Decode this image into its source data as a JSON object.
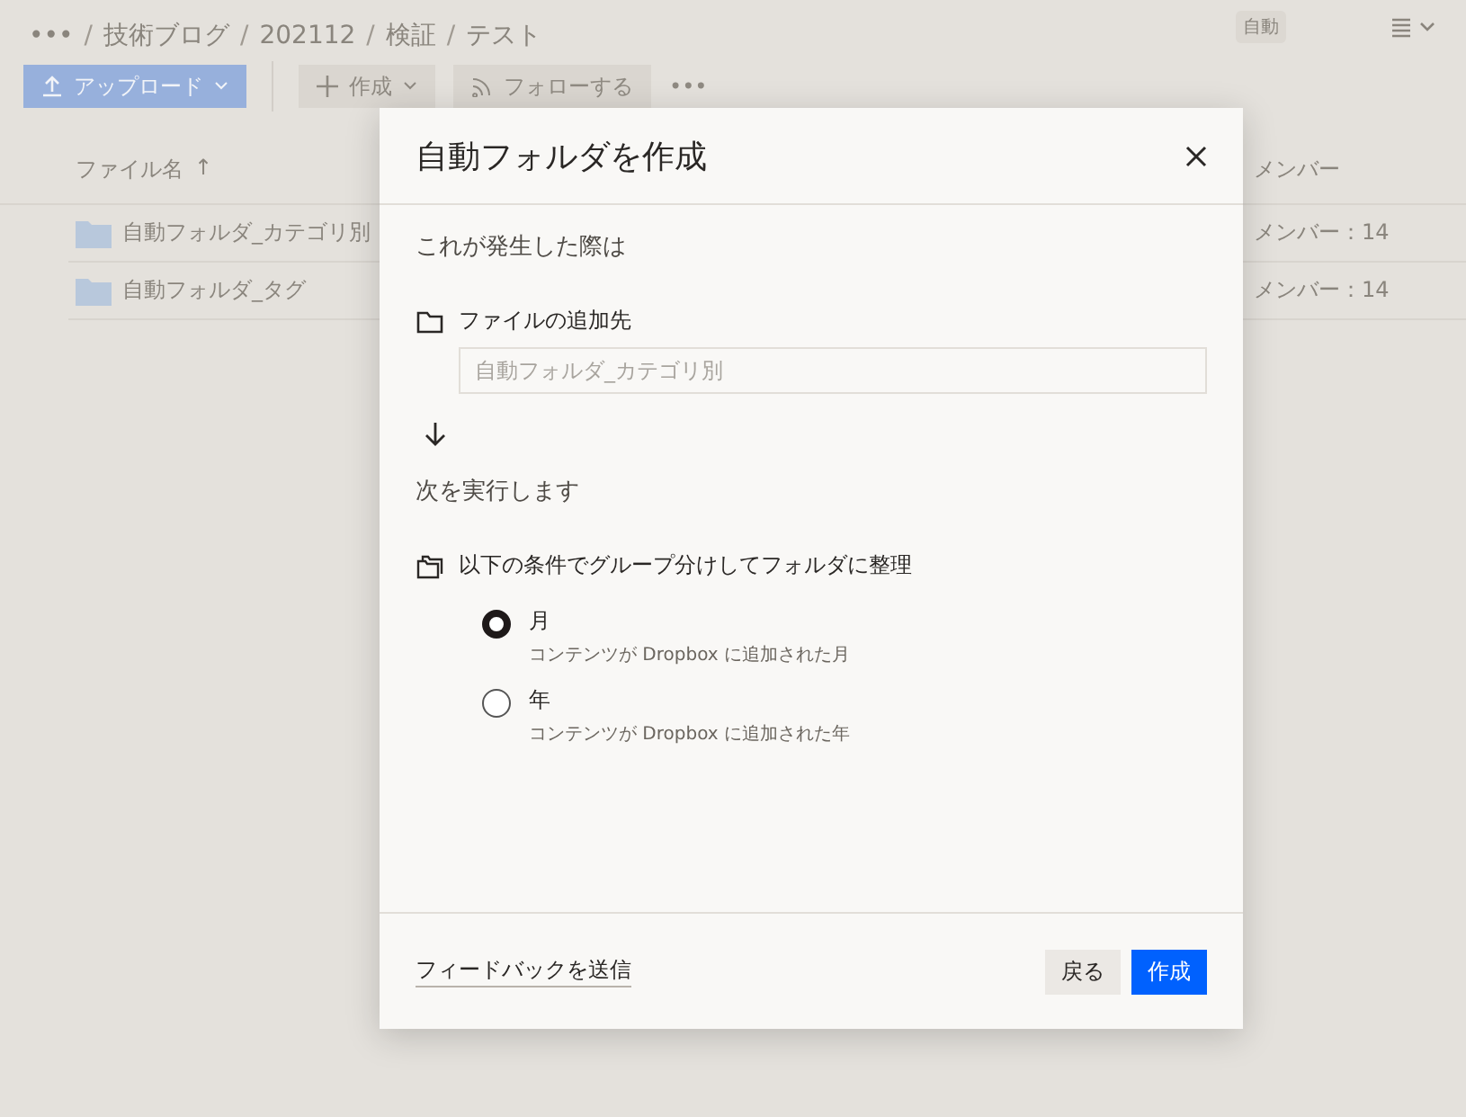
{
  "breadcrumb": {
    "more": "•••",
    "separator": "/",
    "items": [
      "技術ブログ",
      "202112",
      "検証",
      "テスト"
    ]
  },
  "badge": "自動",
  "toolbar": {
    "upload": "アップロード",
    "create": "作成",
    "follow": "フォローする",
    "more": "•••"
  },
  "table": {
    "columns": [
      "ファイル名",
      "メンバー"
    ],
    "sort_indicator": "↑",
    "rows": [
      {
        "name": "自動フォルダ_カテゴリ別",
        "members": "メンバー：14"
      },
      {
        "name": "自動フォルダ_タグ",
        "members": "メンバー：14"
      }
    ]
  },
  "dialog": {
    "title": "自動フォルダを作成",
    "trigger_heading": "これが発生した際は",
    "trigger_label": "ファイルの追加先",
    "trigger_placeholder": "自動フォルダ_カテゴリ別",
    "action_heading": "次を実行します",
    "action_label": "以下の条件でグループ分けしてフォルダに整理",
    "options": [
      {
        "label": "月",
        "description": "コンテンツが Dropbox に追加された月",
        "selected": true
      },
      {
        "label": "年",
        "description": "コンテンツが Dropbox に追加された年",
        "selected": false
      }
    ],
    "feedback": "フィードバックを送信",
    "back": "戻る",
    "create": "作成"
  }
}
